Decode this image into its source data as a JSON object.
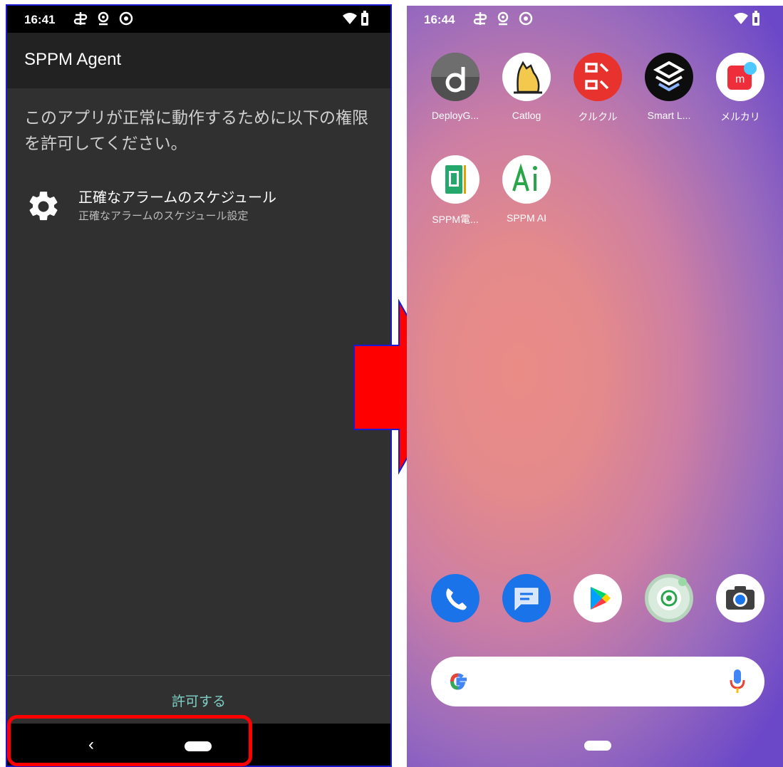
{
  "left": {
    "status_time": "16:41",
    "app_title": "SPPM Agent",
    "intro_text": "このアプリが正常に動作するために以下の権限を許可してください。",
    "permission_title": "正確なアラームのスケジュール",
    "permission_subtitle": "正確なアラームのスケジュール設定",
    "allow_button": "許可する",
    "back_glyph": "‹"
  },
  "right": {
    "status_time": "16:44",
    "apps": [
      {
        "label": "DeployG..."
      },
      {
        "label": "Catlog"
      },
      {
        "label": "クルクル"
      },
      {
        "label": "Smart L..."
      },
      {
        "label": "メルカリ"
      },
      {
        "label": "SPPM電..."
      },
      {
        "label": "SPPM AI"
      }
    ],
    "dock": [
      "phone-icon",
      "messages-icon",
      "play-store-icon",
      "app-icon",
      "camera-icon"
    ]
  },
  "colors": {
    "highlight": "#ff0000",
    "arrow": "#ff0000",
    "arrow_border": "#1a1ad0",
    "allow_text": "#7fd0c6"
  }
}
